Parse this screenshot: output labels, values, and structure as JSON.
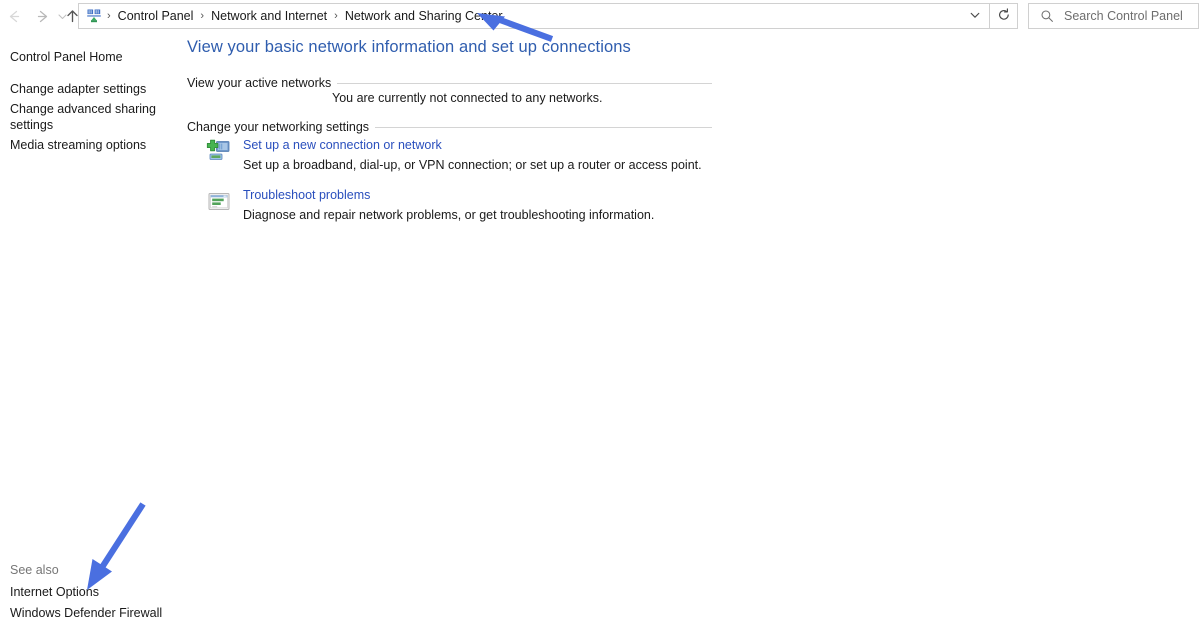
{
  "window": {
    "title": "Network and Sharing Center"
  },
  "toolbar": {
    "back_icon": "arrow-left-icon",
    "forward_icon": "arrow-right-icon",
    "recent_icon": "chevron-down-icon",
    "up_icon": "arrow-up-icon",
    "app_icon": "control-panel-icon",
    "breadcrumb": {
      "separator": "›",
      "items": [
        {
          "label": "Control Panel"
        },
        {
          "label": "Network and Internet"
        },
        {
          "label": "Network and Sharing Center"
        }
      ]
    },
    "address_dropdown_icon": "chevron-down-icon",
    "refresh_icon": "refresh-icon",
    "search": {
      "icon": "search-icon",
      "placeholder": "Search Control Panel",
      "value": ""
    }
  },
  "sidebar": {
    "home_label": "Control Panel Home",
    "items": [
      {
        "label": "Change adapter settings"
      },
      {
        "label": "Change advanced sharing settings"
      },
      {
        "label": "Media streaming options"
      }
    ],
    "see_also": {
      "label": "See also",
      "items": [
        {
          "label": "Internet Options"
        },
        {
          "label": "Windows Defender Firewall"
        }
      ]
    }
  },
  "main": {
    "page_title": "View your basic network information and set up connections",
    "sections": [
      {
        "heading": "View your active networks",
        "body": "You are currently not connected to any networks."
      },
      {
        "heading": "Change your networking settings",
        "tasks": [
          {
            "icon": "new-connection-icon",
            "link": "Set up a new connection or network",
            "description": "Set up a broadband, dial-up, or VPN connection; or set up a router or access point."
          },
          {
            "icon": "troubleshoot-icon",
            "link": "Troubleshoot problems",
            "description": "Diagnose and repair network problems, or get troubleshooting information."
          }
        ]
      }
    ]
  },
  "annotations": [
    {
      "name": "arrow-pointing-to-breadcrumb",
      "color": "#4a6fe0",
      "direction": "up-left"
    },
    {
      "name": "arrow-pointing-to-internet-options",
      "color": "#4a6fe0",
      "direction": "down-left"
    }
  ],
  "colors": {
    "title_blue": "#2f5dae",
    "link_blue": "#2a4fbd",
    "annotation_blue": "#4a6fe0",
    "muted_gray": "#767676",
    "rule_gray": "#d4d4d4",
    "border_gray": "#d0d0d0"
  }
}
